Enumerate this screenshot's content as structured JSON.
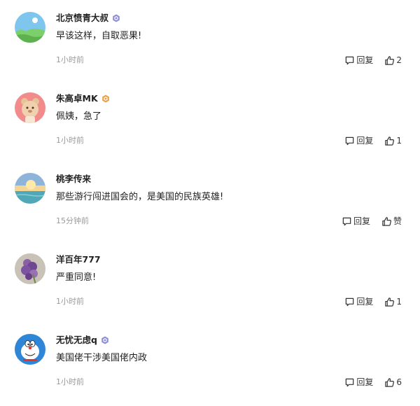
{
  "comments": [
    {
      "username": "北京愤青大叔",
      "badge": "purple",
      "text": "早该这样，自取恶果!",
      "time": "1小时前",
      "reply_label": "回复",
      "like_label": "2",
      "avatar": "landscape-avatar"
    },
    {
      "username": "朱高卓MK",
      "badge": "orange",
      "text": "佩姨，急了",
      "time": "1小时前",
      "reply_label": "回复",
      "like_label": "1",
      "avatar": "bear-avatar"
    },
    {
      "username": "桃李传来",
      "badge": "",
      "text": "那些游行闯进国会的，是美国的民族英雄!",
      "time": "15分钟前",
      "reply_label": "回复",
      "like_label": "赞",
      "avatar": "sunset-sea-avatar"
    },
    {
      "username": "洋百年777",
      "badge": "",
      "text": "严重同意!",
      "time": "1小时前",
      "reply_label": "回复",
      "like_label": "1",
      "avatar": "lilac-flower-avatar"
    },
    {
      "username": "无忧无虑q",
      "badge": "purple",
      "text": "美国佬干涉美国佬内政",
      "time": "1小时前",
      "reply_label": "回复",
      "like_label": "6",
      "avatar": "doraemon-avatar"
    }
  ],
  "colors": {
    "badge_purple": "#8e8ed8",
    "badge_orange": "#e9a04b",
    "muted_text": "#9a9a9a"
  }
}
